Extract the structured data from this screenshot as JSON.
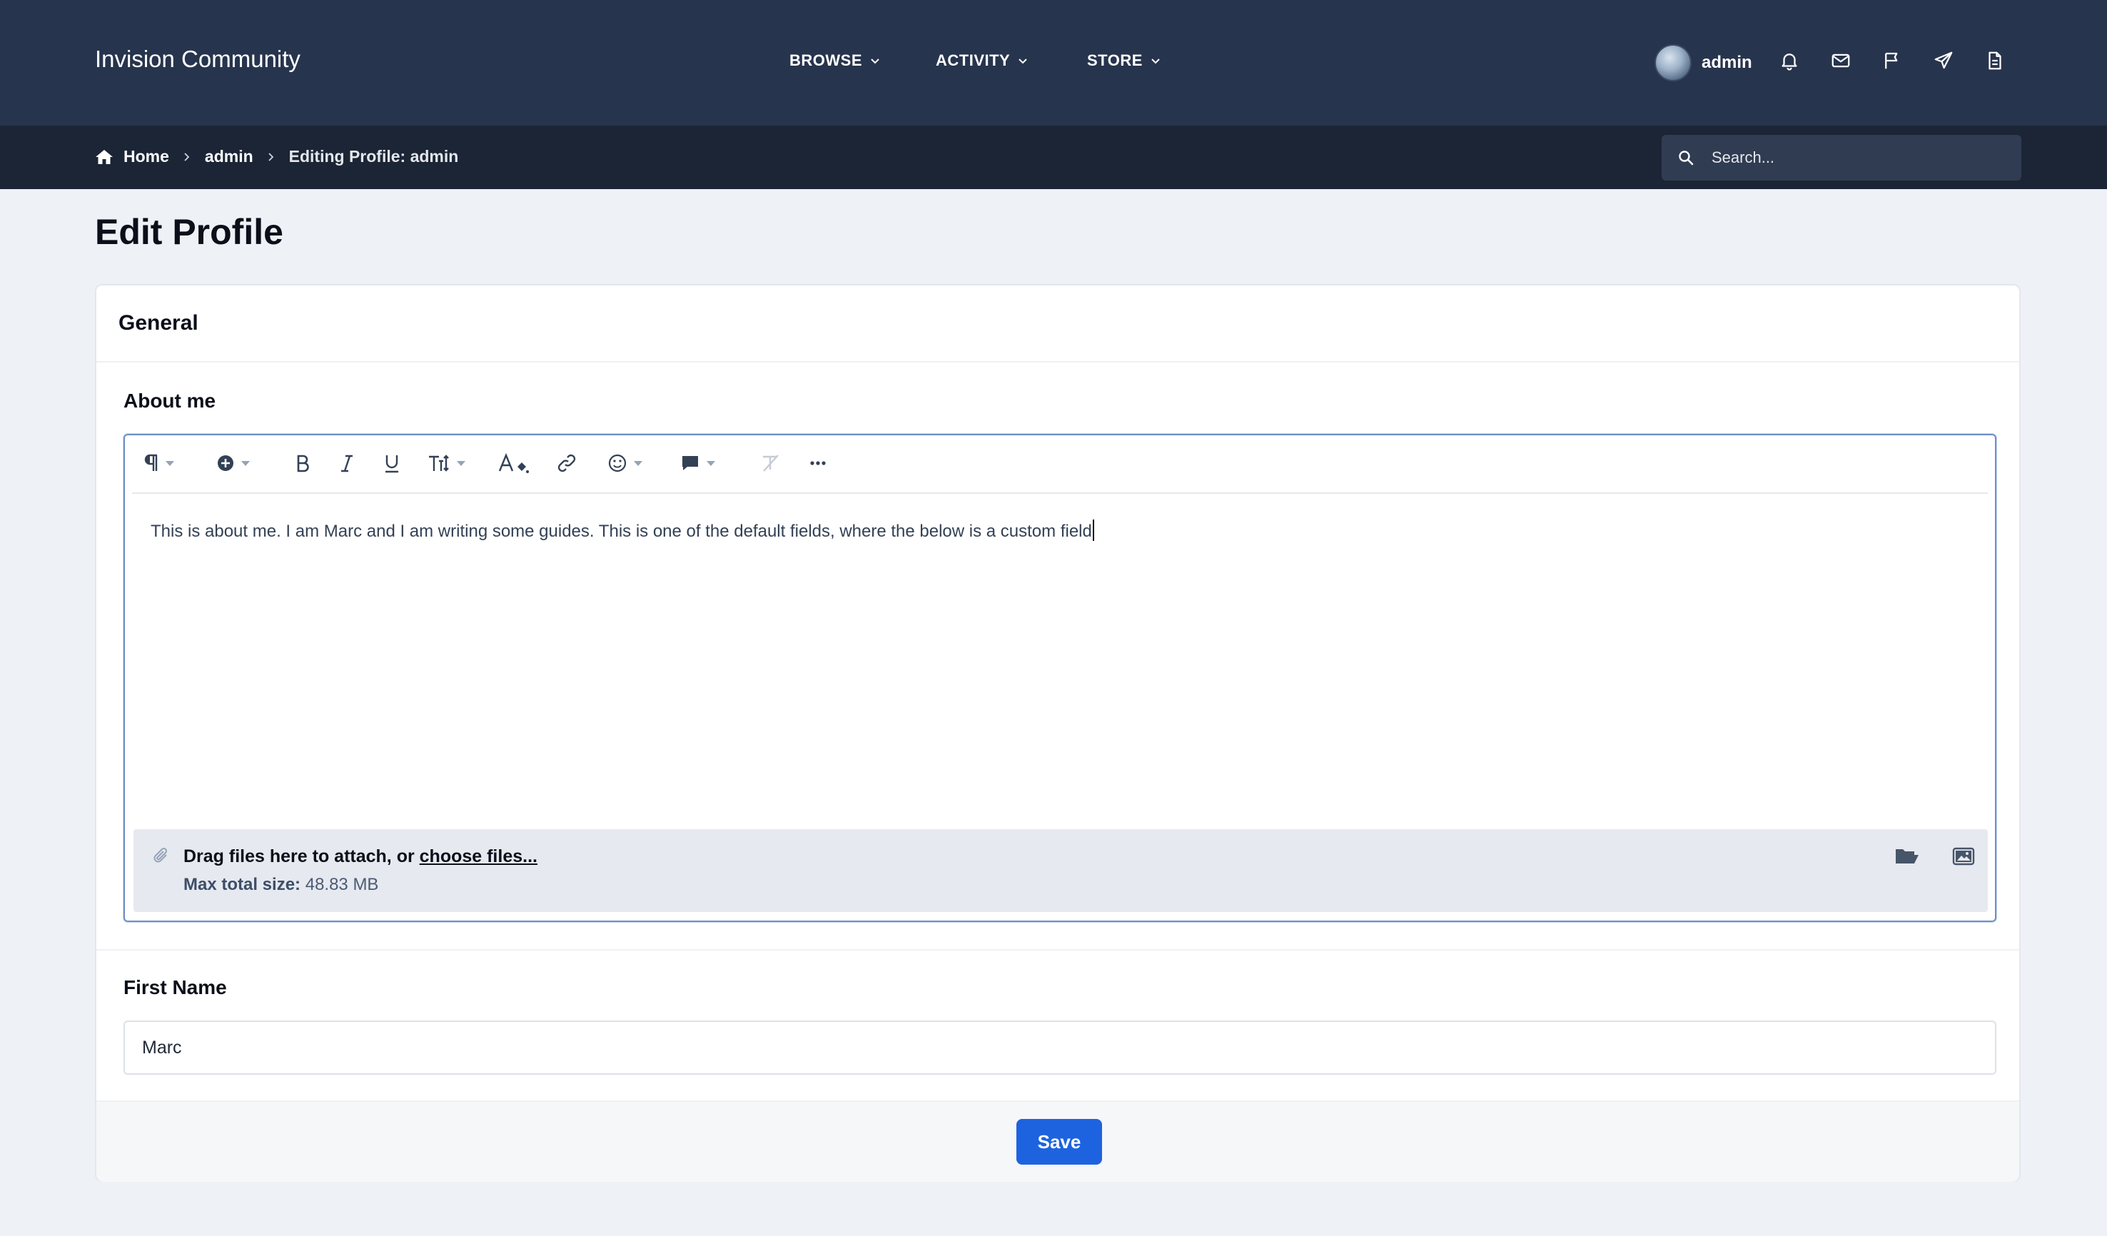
{
  "header": {
    "site_title": "Invision Community",
    "nav": [
      {
        "label": "BROWSE"
      },
      {
        "label": "ACTIVITY"
      },
      {
        "label": "STORE"
      }
    ],
    "user_name": "admin",
    "icons": [
      "bell-icon",
      "mail-icon",
      "flag-icon",
      "send-icon",
      "document-icon"
    ]
  },
  "breadcrumb": {
    "home": "Home",
    "level1": "admin",
    "current": "Editing Profile: admin"
  },
  "search": {
    "placeholder": "Search..."
  },
  "page": {
    "title": "Edit Profile",
    "section_title": "General",
    "about_label": "About me",
    "about_text": "This is about me. I am Marc and I am writing some guides. This is one of the default fields, where the below is a custom field",
    "attach_text": "Drag files here to attach, or ",
    "attach_link": "choose files...",
    "max_size_label": "Max total size:",
    "max_size_value": " 48.83 MB",
    "first_name_label": "First Name",
    "first_name_value": "Marc",
    "save_label": "Save"
  },
  "colors": {
    "header_bg": "#27344d",
    "breadcrumb_bg": "#1b2536",
    "primary_button": "#1d63e0",
    "editor_focus_border": "#6d8fc4"
  }
}
